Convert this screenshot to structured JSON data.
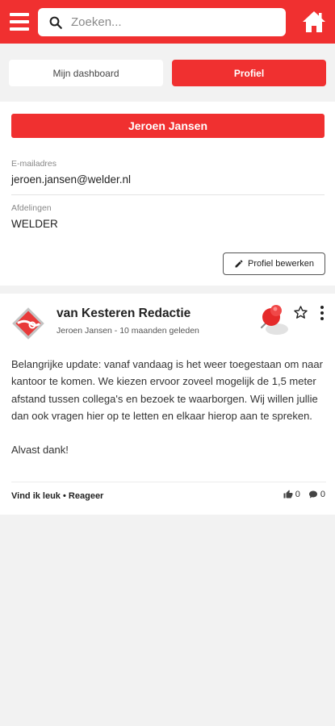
{
  "header": {
    "search_placeholder": "Zoeken...",
    "brand_color": "#f03030"
  },
  "tabs": [
    {
      "label": "Mijn dashboard",
      "active": false
    },
    {
      "label": "Profiel",
      "active": true
    }
  ],
  "profile": {
    "name": "Jeroen Jansen",
    "email_label": "E-mailadres",
    "email": "jeroen.jansen@welder.nl",
    "department_label": "Afdelingen",
    "department": "WELDER",
    "edit_label": "Profiel bewerken"
  },
  "post": {
    "author": "van Kesteren Redactie",
    "meta": "Jeroen Jansen - 10 maanden geleden",
    "body": [
      "Belangrijke update: vanaf vandaag is het weer toegestaan om naar kantoor te komen. We kiezen ervoor zoveel mogelijk de 1,5 meter afstand tussen collega's en bezoek te waarborgen. Wij willen jullie dan ook vragen hier op te letten en elkaar hierop aan te spreken.",
      "Alvast dank!"
    ],
    "like_label": "Vind ik leuk",
    "separator": "•",
    "reply_label": "Reageer",
    "likes": "0",
    "comments": "0",
    "icons": [
      "pin-icon",
      "star-icon",
      "more-vertical-icon",
      "thumbs-up-icon",
      "comment-icon"
    ]
  }
}
